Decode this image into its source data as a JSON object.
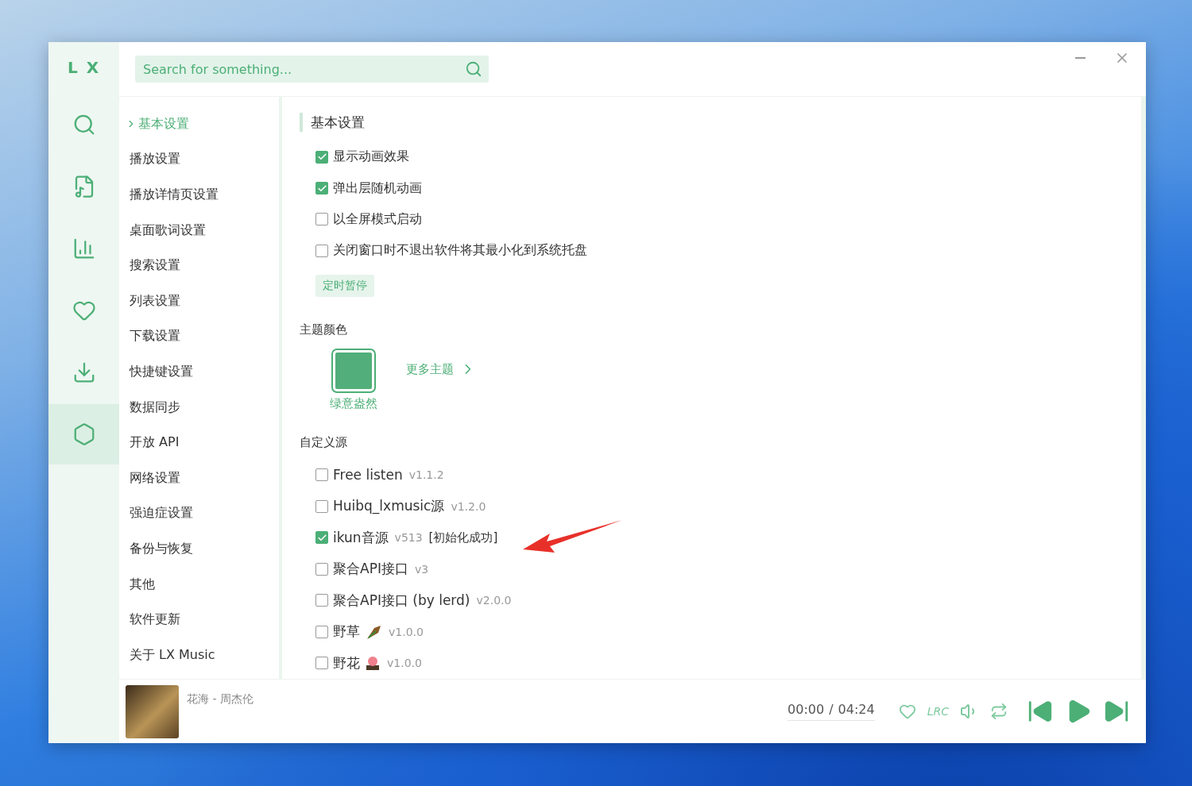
{
  "logo": "L X",
  "rail": [
    {
      "kind": "search",
      "selected": false
    },
    {
      "kind": "music",
      "selected": false
    },
    {
      "kind": "chart",
      "selected": false
    },
    {
      "kind": "heart",
      "selected": false
    },
    {
      "kind": "download",
      "selected": false
    },
    {
      "kind": "settings",
      "selected": true
    }
  ],
  "search": {
    "placeholder": "Search for something..."
  },
  "settings_menu": [
    {
      "label": "基本设置",
      "selected": true
    },
    {
      "label": "播放设置",
      "selected": false
    },
    {
      "label": "播放详情页设置",
      "selected": false
    },
    {
      "label": "桌面歌词设置",
      "selected": false
    },
    {
      "label": "搜索设置",
      "selected": false
    },
    {
      "label": "列表设置",
      "selected": false
    },
    {
      "label": "下载设置",
      "selected": false
    },
    {
      "label": "快捷键设置",
      "selected": false
    },
    {
      "label": "数据同步",
      "selected": false
    },
    {
      "label": "开放 API",
      "selected": false
    },
    {
      "label": "网络设置",
      "selected": false
    },
    {
      "label": "强迫症设置",
      "selected": false
    },
    {
      "label": "备份与恢复",
      "selected": false
    },
    {
      "label": "其他",
      "selected": false
    },
    {
      "label": "软件更新",
      "selected": false
    },
    {
      "label": "关于 LX Music",
      "selected": false
    }
  ],
  "section_title": "基本设置",
  "options": [
    {
      "label": "显示动画效果",
      "checked": true
    },
    {
      "label": "弹出层随机动画",
      "checked": true
    },
    {
      "label": "以全屏模式启动",
      "checked": false
    },
    {
      "label": "关闭窗口时不退出软件将其最小化到系统托盘",
      "checked": false
    }
  ],
  "timer_button": "定时暂停",
  "theme": {
    "heading": "主题颜色",
    "themes": [
      {
        "name": "绿意盎然",
        "selected": true,
        "color": "#52ae7a"
      }
    ],
    "more_link": "更多主题"
  },
  "custom_sources": {
    "heading": "自定义源",
    "items": [
      {
        "name": "Free listen",
        "version": "v1.1.2",
        "checked": false,
        "kind": "plain"
      },
      {
        "name": "Huibq_lxmusic源",
        "version": "v1.2.0",
        "checked": false,
        "kind": "plain"
      },
      {
        "name": "ikun音源",
        "version": "v513",
        "status": "[初始化成功]",
        "checked": true,
        "kind": "plain"
      },
      {
        "name": "聚合API接口",
        "version": "v3",
        "checked": false,
        "kind": "plain"
      },
      {
        "name": "聚合API接口 (by lerd)",
        "version": "v2.0.0",
        "checked": false,
        "kind": "plain"
      },
      {
        "name": "野草",
        "version": "v1.0.0",
        "checked": false,
        "kind": "grass"
      },
      {
        "name": "野花",
        "version": "v1.0.0",
        "checked": false,
        "kind": "flower"
      }
    ]
  },
  "player": {
    "title": "花海 - 周杰伦",
    "current_time": "00:00",
    "time_separator": "/",
    "total_time": "04:24",
    "lyrics_toggle": "LRC"
  }
}
